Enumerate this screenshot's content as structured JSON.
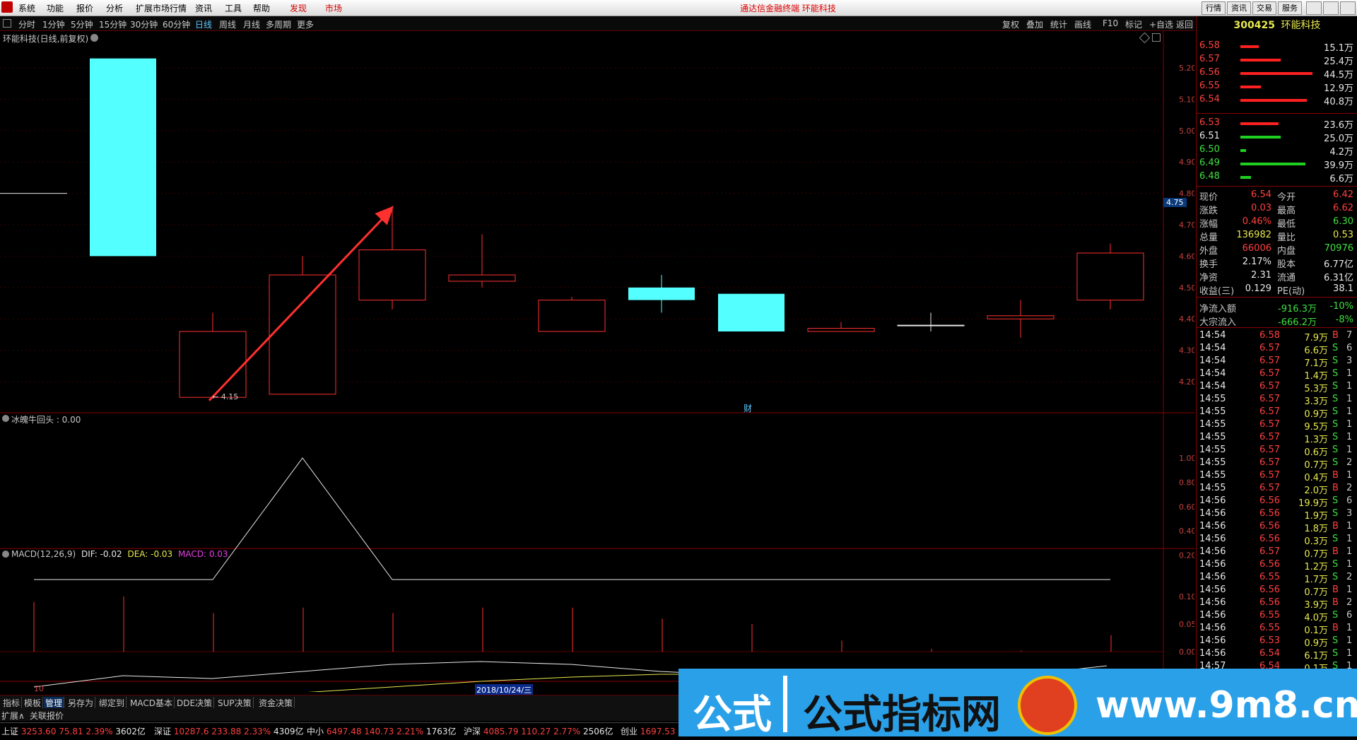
{
  "menu": {
    "items": [
      "系统",
      "功能",
      "报价",
      "分析",
      "扩展市场行情",
      "资讯",
      "工具",
      "帮助"
    ],
    "items_red": [
      "发现",
      "市场"
    ],
    "window_title": "通达信金融终端  环能科技",
    "right_buttons": [
      "行情",
      "资讯",
      "交易",
      "服务"
    ]
  },
  "periods": {
    "items": [
      "分时",
      "1分钟",
      "5分钟",
      "15分钟",
      "30分钟",
      "60分钟",
      "日线",
      "周线",
      "月线",
      "多周期",
      "更多"
    ],
    "active": "日线",
    "right_items": [
      "复权",
      "叠加",
      "统计",
      "画线",
      "F10",
      "标记",
      "+自选",
      "返回"
    ]
  },
  "chart": {
    "title": "环能科技(日线,前复权)",
    "current_price_tag": "4.75",
    "low_label": "← 4.15",
    "cai_label": "财",
    "date_label": "2018/10/24/三",
    "x_start_label": "10",
    "price_axis": [
      "5.20",
      "5.10",
      "5.00",
      "4.90",
      "4.80",
      "4.70",
      "4.60",
      "4.50",
      "4.40",
      "4.30",
      "4.20"
    ],
    "indicator_title": "冰魄牛回头 : 0.00",
    "indicator_axis": [
      "1.00",
      "0.80",
      "0.60",
      "0.40",
      "0.20"
    ],
    "macd_title": "MACD(12,26,9)",
    "macd_dif": "DIF: -0.02",
    "macd_dea": "DEA: -0.03",
    "macd_macd": "MACD: 0.03",
    "macd_axis": [
      "0.10",
      "0.05",
      "0.00",
      "-0.05"
    ],
    "colors": {
      "up": "#ff3030",
      "down": "#54ffff",
      "arrow": "#ff3030"
    }
  },
  "chart_data": {
    "type": "candlestick",
    "candles": [
      {
        "open": 5.23,
        "close": 4.6,
        "high": 5.23,
        "low": 4.6,
        "dir": "down"
      },
      {
        "open": 4.15,
        "close": 4.36,
        "high": 4.42,
        "low": 4.15,
        "dir": "up"
      },
      {
        "open": 4.16,
        "close": 4.54,
        "high": 4.6,
        "low": 4.16,
        "dir": "up"
      },
      {
        "open": 4.46,
        "close": 4.62,
        "high": 4.76,
        "low": 4.43,
        "dir": "up"
      },
      {
        "open": 4.52,
        "close": 4.54,
        "high": 4.67,
        "low": 4.5,
        "dir": "up"
      },
      {
        "open": 4.36,
        "close": 4.46,
        "high": 4.47,
        "low": 4.36,
        "dir": "up"
      },
      {
        "open": 4.5,
        "close": 4.46,
        "high": 4.54,
        "low": 4.42,
        "dir": "down"
      },
      {
        "open": 4.48,
        "close": 4.36,
        "high": 4.48,
        "low": 4.36,
        "dir": "down"
      },
      {
        "open": 4.36,
        "close": 4.37,
        "high": 4.39,
        "low": 4.36,
        "dir": "up"
      },
      {
        "open": 4.38,
        "close": 4.38,
        "high": 4.42,
        "low": 4.36,
        "dir": "flat"
      },
      {
        "open": 4.4,
        "close": 4.41,
        "high": 4.46,
        "low": 4.34,
        "dir": "up"
      },
      {
        "open": 4.46,
        "close": 4.61,
        "high": 4.64,
        "low": 4.43,
        "dir": "up"
      }
    ],
    "indicator_values": [
      0,
      0,
      1,
      0,
      0,
      0,
      0,
      0,
      0,
      0,
      0,
      0
    ],
    "macd_hist": [
      0.09,
      0.1,
      0.07,
      0.08,
      0.07,
      0.08,
      0.08,
      0.06,
      0.05,
      0.02,
      0.005,
      0.002,
      0.03
    ],
    "prev_line": 4.8
  },
  "orderbook": {
    "stock_code": "300425",
    "stock_name": "环能科技",
    "asks": [
      {
        "price": "6.58",
        "vol": "15.1万",
        "bar": 0.25
      },
      {
        "price": "6.57",
        "vol": "25.4万",
        "bar": 0.55
      },
      {
        "price": "6.56",
        "vol": "44.5万",
        "bar": 0.98
      },
      {
        "price": "6.55",
        "vol": "12.9万",
        "bar": 0.28
      },
      {
        "price": "6.54",
        "vol": "40.8万",
        "bar": 0.9
      }
    ],
    "bids": [
      {
        "price": "6.53",
        "vol": "23.6万",
        "bar": 0.52,
        "color": "red"
      },
      {
        "price": "6.51",
        "vol": "25.0万",
        "bar": 0.55,
        "color": "white"
      },
      {
        "price": "6.50",
        "vol": "4.2万",
        "bar": 0.08,
        "color": "green"
      },
      {
        "price": "6.49",
        "vol": "39.9万",
        "bar": 0.88,
        "color": "green"
      },
      {
        "price": "6.48",
        "vol": "6.6万",
        "bar": 0.14,
        "color": "green"
      }
    ]
  },
  "quote": [
    {
      "l1": "现价",
      "v1": "6.54",
      "c1": "red",
      "l2": "今开",
      "v2": "6.42",
      "c2": "red"
    },
    {
      "l1": "涨跌",
      "v1": "0.03",
      "c1": "red",
      "l2": "最高",
      "v2": "6.62",
      "c2": "red"
    },
    {
      "l1": "涨幅",
      "v1": "0.46%",
      "c1": "red",
      "l2": "最低",
      "v2": "6.30",
      "c2": "green"
    },
    {
      "l1": "总量",
      "v1": "136982",
      "c1": "yellow",
      "l2": "量比",
      "v2": "0.53",
      "c2": "yellow"
    },
    {
      "l1": "外盘",
      "v1": "66006",
      "c1": "red",
      "l2": "内盘",
      "v2": "70976",
      "c2": "green"
    },
    {
      "l1": "换手",
      "v1": "2.17%",
      "c1": "white",
      "l2": "股本",
      "v2": "6.77亿",
      "c2": "white"
    },
    {
      "l1": "净资",
      "v1": "2.31",
      "c1": "white",
      "l2": "流通",
      "v2": "6.31亿",
      "c2": "white"
    },
    {
      "l1": "收益(三)",
      "v1": "0.129",
      "c1": "white",
      "l2": "PE(动)",
      "v2": "38.1",
      "c2": "white"
    }
  ],
  "flow": [
    {
      "label": "净流入额",
      "value": "-916.3万",
      "pct": "-10%"
    },
    {
      "label": "大宗流入",
      "value": "-666.2万",
      "pct": "-8%"
    }
  ],
  "ticks": [
    {
      "t": "14:54",
      "p": "6.58",
      "pc": "red",
      "v": "7.9万",
      "f": "B",
      "n": "7"
    },
    {
      "t": "14:54",
      "p": "6.57",
      "pc": "red",
      "v": "6.6万",
      "f": "S",
      "n": "6"
    },
    {
      "t": "14:54",
      "p": "6.57",
      "pc": "red",
      "v": "7.1万",
      "f": "S",
      "n": "3"
    },
    {
      "t": "14:54",
      "p": "6.57",
      "pc": "red",
      "v": "1.4万",
      "f": "S",
      "n": "1"
    },
    {
      "t": "14:54",
      "p": "6.57",
      "pc": "red",
      "v": "5.3万",
      "f": "S",
      "n": "1"
    },
    {
      "t": "14:55",
      "p": "6.57",
      "pc": "red",
      "v": "3.3万",
      "f": "S",
      "n": "1"
    },
    {
      "t": "14:55",
      "p": "6.57",
      "pc": "red",
      "v": "0.9万",
      "f": "S",
      "n": "1"
    },
    {
      "t": "14:55",
      "p": "6.57",
      "pc": "red",
      "v": "9.5万",
      "f": "S",
      "n": "1"
    },
    {
      "t": "14:55",
      "p": "6.57",
      "pc": "red",
      "v": "1.3万",
      "f": "S",
      "n": "1"
    },
    {
      "t": "14:55",
      "p": "6.57",
      "pc": "red",
      "v": "0.6万",
      "f": "S",
      "n": "1"
    },
    {
      "t": "14:55",
      "p": "6.57",
      "pc": "red",
      "v": "0.7万",
      "f": "S",
      "n": "2"
    },
    {
      "t": "14:55",
      "p": "6.57",
      "pc": "red",
      "v": "0.4万",
      "f": "B",
      "n": "1"
    },
    {
      "t": "14:55",
      "p": "6.57",
      "pc": "red",
      "v": "2.0万",
      "f": "B",
      "n": "2"
    },
    {
      "t": "14:56",
      "p": "6.56",
      "pc": "red",
      "v": "19.9万",
      "f": "S",
      "n": "6"
    },
    {
      "t": "14:56",
      "p": "6.56",
      "pc": "red",
      "v": "1.9万",
      "f": "S",
      "n": "3"
    },
    {
      "t": "14:56",
      "p": "6.56",
      "pc": "red",
      "v": "1.8万",
      "f": "B",
      "n": "1"
    },
    {
      "t": "14:56",
      "p": "6.56",
      "pc": "red",
      "v": "0.3万",
      "f": "S",
      "n": "1"
    },
    {
      "t": "14:56",
      "p": "6.57",
      "pc": "red",
      "v": "0.7万",
      "f": "B",
      "n": "1"
    },
    {
      "t": "14:56",
      "p": "6.56",
      "pc": "red",
      "v": "1.2万",
      "f": "S",
      "n": "1"
    },
    {
      "t": "14:56",
      "p": "6.55",
      "pc": "red",
      "v": "1.7万",
      "f": "S",
      "n": "2"
    },
    {
      "t": "14:56",
      "p": "6.56",
      "pc": "red",
      "v": "0.7万",
      "f": "B",
      "n": "1"
    },
    {
      "t": "14:56",
      "p": "6.56",
      "pc": "red",
      "v": "3.9万",
      "f": "B",
      "n": "2"
    },
    {
      "t": "14:56",
      "p": "6.55",
      "pc": "red",
      "v": "4.0万",
      "f": "S",
      "n": "6"
    },
    {
      "t": "14:56",
      "p": "6.55",
      "pc": "red",
      "v": "0.1万",
      "f": "B",
      "n": "1"
    },
    {
      "t": "14:56",
      "p": "6.53",
      "pc": "red",
      "v": "0.9万",
      "f": "S",
      "n": "1"
    },
    {
      "t": "14:56",
      "p": "6.54",
      "pc": "red",
      "v": "6.1万",
      "f": "S",
      "n": "1"
    },
    {
      "t": "14:57",
      "p": "6.54",
      "pc": "red",
      "v": "0.1万",
      "f": "S",
      "n": "1"
    }
  ],
  "tabs": {
    "items": [
      "指标",
      "模板",
      "管理",
      "另存为",
      "绑定到",
      "MACD基本",
      "DDE决策",
      "SUP决策",
      "资金决策"
    ],
    "selected": "管理",
    "ext_items": [
      "扩展∧",
      "关联报价"
    ]
  },
  "indices": [
    {
      "name": "上证",
      "val": "3253.60",
      "chg": "75.81",
      "pct": "2.39%",
      "amt": "3602亿"
    },
    {
      "name": "深证",
      "val": "10287.6",
      "chg": "233.88",
      "pct": "2.33%",
      "amt": "4309亿"
    },
    {
      "name": "中小",
      "val": "6497.48",
      "chg": "140.73",
      "pct": "2.21%",
      "amt": "1763亿"
    },
    {
      "name": "沪深",
      "val": "4085.79",
      "chg": "110.27",
      "pct": "2.77%",
      "amt": "2506亿"
    },
    {
      "name": "创业",
      "val": "1697.53",
      "chg": "",
      "pct": "",
      "amt": ""
    }
  ],
  "watermark": {
    "left_text": "公式",
    "main_text": "公式指标网",
    "url": "www.9m8.cn"
  }
}
